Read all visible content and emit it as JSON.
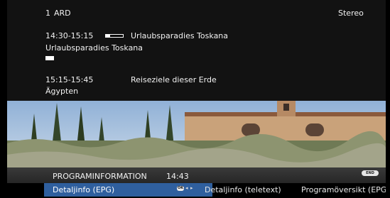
{
  "channel": {
    "number": "1",
    "name": "ARD",
    "audio": "Stereo"
  },
  "current_program": {
    "time": "14:30-15:15",
    "title": "Urlaubsparadies Toskana",
    "subtitle": "Urlaubsparadies Toskana",
    "progress": 0.25
  },
  "next_program": {
    "time": "15:15-15:45",
    "title": "Reiseziele dieser Erde",
    "subtitle": "Ägypten"
  },
  "menu": {
    "header": "PROGRAMINFORMATION",
    "clock": "14:43",
    "end_label": "END",
    "ok_label": "OK",
    "tabs": [
      "Detaljinfo (EPG)",
      "Detaljinfo (teletext)",
      "Programöversikt (EPG)"
    ]
  },
  "colors": {
    "highlight": "#2f5f9e",
    "panel": "#121212"
  }
}
